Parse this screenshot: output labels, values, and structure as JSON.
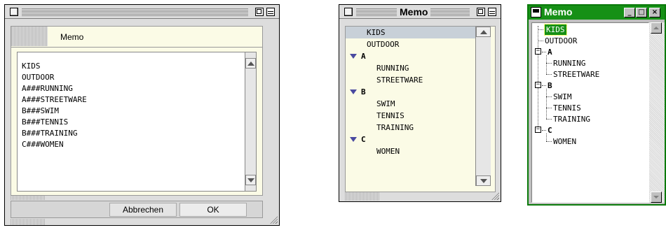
{
  "window1": {
    "tab_label": "Memo",
    "lines": [
      "KIDS",
      "OUTDOOR",
      "A###RUNNING",
      "A###STREETWARE",
      "B###SWIM",
      "B###TENNIS",
      "B###TRAINING",
      "C###WOMEN"
    ],
    "cancel_label": "Abbrechen",
    "ok_label": "OK"
  },
  "window2": {
    "title": "Memo",
    "items": [
      {
        "label": "KIDS",
        "level": 1,
        "selected": true
      },
      {
        "label": "OUTDOOR",
        "level": 1
      },
      {
        "label": "A",
        "level": 0,
        "group": true
      },
      {
        "label": "RUNNING",
        "level": 2
      },
      {
        "label": "STREETWARE",
        "level": 2
      },
      {
        "label": "B",
        "level": 0,
        "group": true
      },
      {
        "label": "SWIM",
        "level": 2
      },
      {
        "label": "TENNIS",
        "level": 2
      },
      {
        "label": "TRAINING",
        "level": 2
      },
      {
        "label": "C",
        "level": 0,
        "group": true
      },
      {
        "label": "WOMEN",
        "level": 2
      }
    ]
  },
  "window3": {
    "title": "Memo",
    "min_icon": "minimize-icon",
    "max_icon": "maximize-icon",
    "close_icon": "close-icon",
    "accent_color": "#169016",
    "items": [
      {
        "label": "KIDS",
        "selected": true
      },
      {
        "label": "OUTDOOR"
      },
      {
        "label": "A",
        "group": true
      },
      {
        "label": "RUNNING"
      },
      {
        "label": "STREETWARE"
      },
      {
        "label": "B",
        "group": true
      },
      {
        "label": "SWIM"
      },
      {
        "label": "TENNIS"
      },
      {
        "label": "TRAINING"
      },
      {
        "label": "C",
        "group": true
      },
      {
        "label": "WOMEN"
      }
    ]
  }
}
